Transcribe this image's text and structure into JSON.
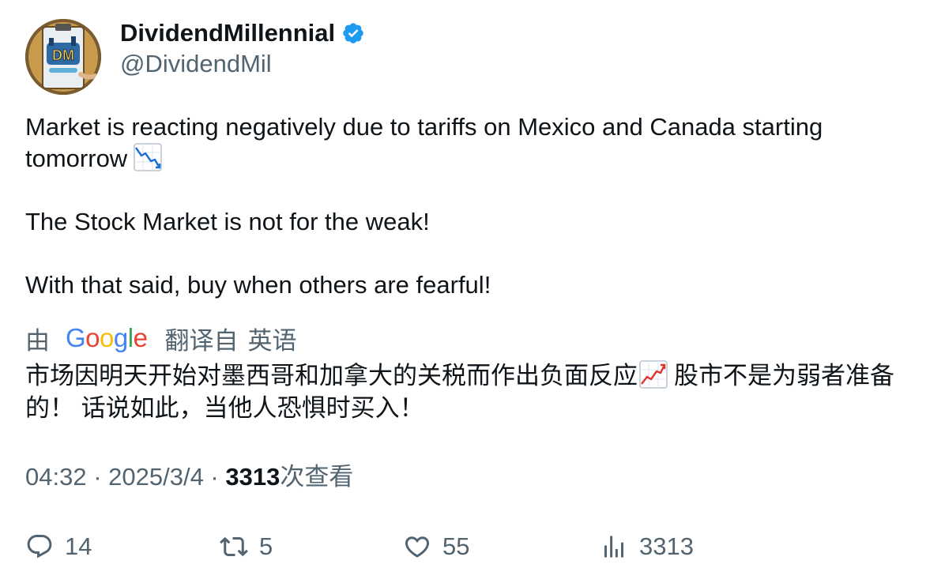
{
  "author": {
    "display_name": "DividendMillennial",
    "handle": "@DividendMil",
    "verified": true,
    "avatar_text": "DM"
  },
  "tweet": {
    "lines": [
      "Market is reacting negatively due to tariffs on Mexico and Canada starting tomorrow",
      "The Stock Market is not for the weak!",
      "With that said, buy when others are fearful!"
    ],
    "emoji_1": "chart-decreasing"
  },
  "translation": {
    "by_label": "由",
    "provider": "Google",
    "from_label": "翻译自",
    "language": "英语",
    "text_part1": "市场因明天开始对墨西哥和加拿大的关税而作出负面反应",
    "text_part2": "股市不是为弱者准备的！ 话说如此，当他人恐惧时买入！",
    "emoji": "chart-increasing"
  },
  "meta": {
    "time": "04:32",
    "separator": " · ",
    "date": "2025/3/4",
    "views_count": "3313",
    "views_label": "次查看"
  },
  "actions": {
    "replies": "14",
    "retweets": "5",
    "likes": "55",
    "views": "3313"
  },
  "colors": {
    "text_primary": "#0f1419",
    "text_secondary": "#536471",
    "verified_blue": "#1d9bf0"
  }
}
